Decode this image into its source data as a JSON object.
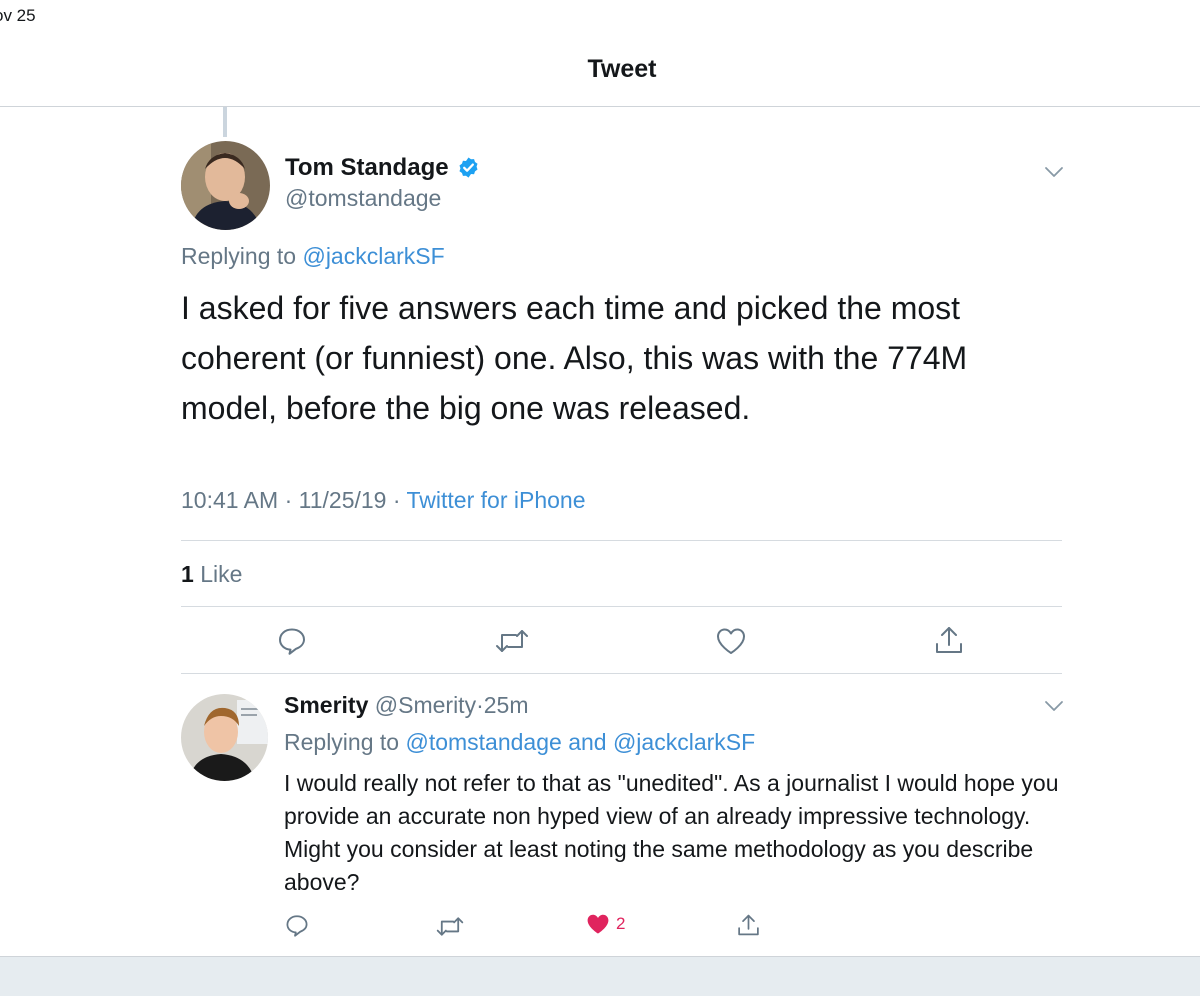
{
  "status_bar": {
    "time": "ov 25"
  },
  "nav": {
    "title": "Tweet"
  },
  "tweet": {
    "author": {
      "name": "Tom Standage",
      "handle": "@tomstandage"
    },
    "replying_prefix": "Replying to",
    "replying_to": "@jackclarkSF",
    "text": "I asked for five answers each time and picked the most coherent (or funniest) one. Also, this was with the 774M model, before the big one was released.",
    "time": "10:41 AM",
    "date": "11/25/19",
    "source": "Twitter for iPhone",
    "separator": "·",
    "likes_count": "1",
    "likes_label": "Like"
  },
  "reply": {
    "author": {
      "name": "Smerity",
      "handle": "@Smerity"
    },
    "separator": "·",
    "age": "25m",
    "replying_prefix": "Replying to",
    "mention_1": "@tomstandage",
    "conjunction": "and",
    "mention_2": "@jackclarkSF",
    "text": "I would really not refer to that as \"unedited\". As a journalist I would hope you provide an accurate non hyped view of an already impressive technology. Might you consider at least noting the same methodology as you describe above?",
    "like_count": "2"
  },
  "colors": {
    "link": "#3d8fd6",
    "secondary_text": "#657786",
    "like_active": "#e0245e",
    "verified": "#1da1f2",
    "icon_gray": "#657786"
  },
  "icons": [
    "verified-badge-icon",
    "chevron-down-icon",
    "reply-icon",
    "retweet-icon",
    "like-icon",
    "share-icon"
  ]
}
